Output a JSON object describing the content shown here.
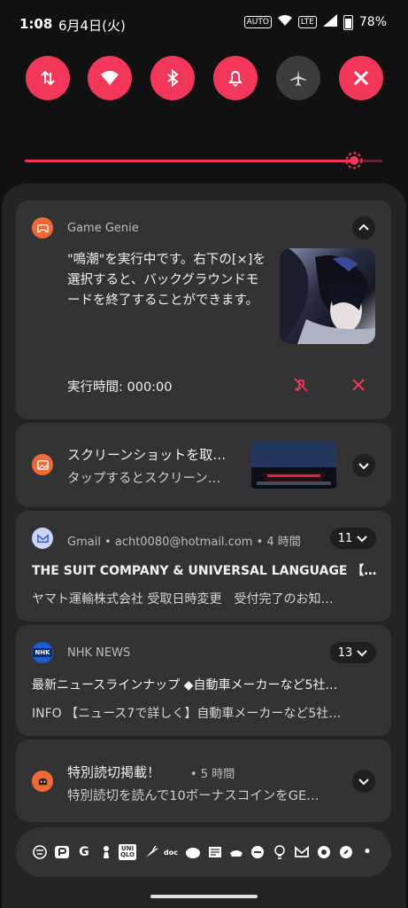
{
  "status_bar": {
    "time": "1:08",
    "date": "6月4日(火)",
    "indicator_small": "AUTO",
    "wifi_badge": "6",
    "lte_label": "LTE",
    "battery": "78%"
  },
  "quick_settings": [
    {
      "icon": "mobile-data-icon",
      "active": true
    },
    {
      "icon": "wifi-icon",
      "badge": "6",
      "active": true
    },
    {
      "icon": "bluetooth-icon",
      "active": true
    },
    {
      "icon": "bell-icon",
      "active": true
    },
    {
      "icon": "airplane-icon",
      "active": false
    },
    {
      "icon": "x-mode-icon",
      "active": true
    }
  ],
  "brightness": {
    "level": 0.92
  },
  "colors": {
    "accent": "#f2375b",
    "card": "#333335",
    "shade": "#242426",
    "app_orange": "#f06a35"
  },
  "notifications": {
    "game_genie": {
      "app_name": "Game Genie",
      "body": "\"鳴潮\"を実行中です。右下の[×]を選択すると、バックグラウンドモードを終了することができます。",
      "runtime": "実行時間: 000:00"
    },
    "screenshot": {
      "title": "スクリーンショットを取…",
      "text": "タップするとスクリーン…"
    },
    "gmail": {
      "header": "Gmail • acht0080@hotmail.com • 4 時間",
      "count": "11",
      "line1": "THE SUIT COMPANY & UNIVERSAL LANGUAGE 【今…",
      "line2": "ヤマト運輸株式会社 受取日時変更　受付完了のお知…"
    },
    "nhk": {
      "app_name": "NHK NEWS",
      "icon_text": "NHK",
      "count": "13",
      "line1": "最新ニュースラインナップ ◆自動車メーカーなど5社…",
      "line2": "INFO 【ニュース7で詳しく】自動車メーカーなど5社…"
    },
    "manga": {
      "title": "特別読切掲載！",
      "time": "• 5 時間",
      "text": "特別読切を読んで10ボーナスコインをGE…"
    }
  },
  "dock": {
    "uniqlo": "UNI QLO",
    "docomo": "doc",
    "g_letter": "G",
    "more": "•"
  }
}
